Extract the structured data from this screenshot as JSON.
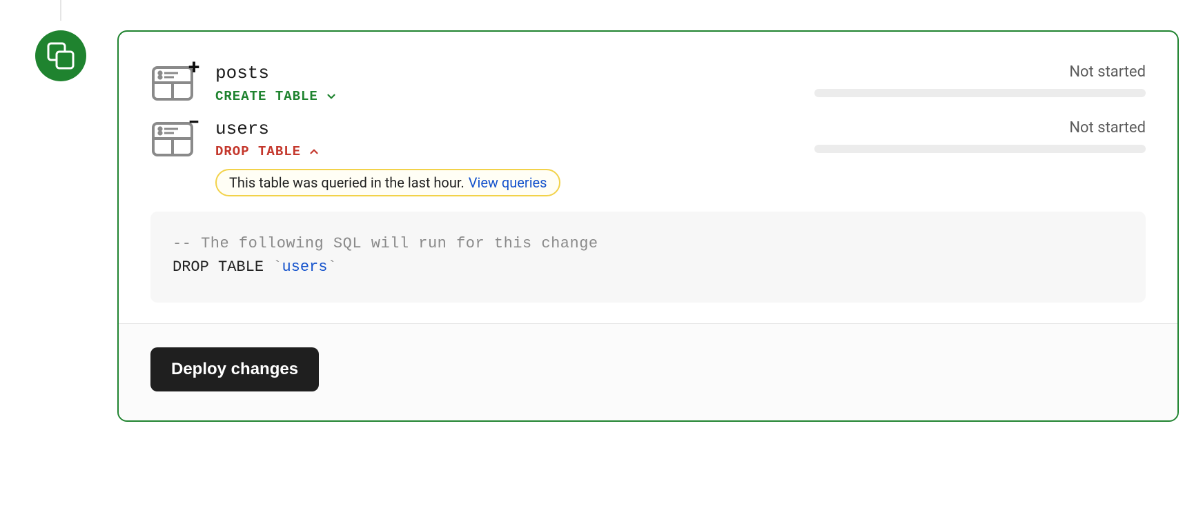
{
  "changes": [
    {
      "table_name": "posts",
      "operation_label": "CREATE TABLE",
      "status": "Not started"
    },
    {
      "table_name": "users",
      "operation_label": "DROP TABLE",
      "status": "Not started"
    }
  ],
  "warning": {
    "text": "This table was queried in the last hour.",
    "link_label": "View queries"
  },
  "sql": {
    "comment": "-- The following SQL will run for this change",
    "keyword": "DROP TABLE",
    "identifier": "users"
  },
  "footer": {
    "deploy_label": "Deploy changes"
  }
}
